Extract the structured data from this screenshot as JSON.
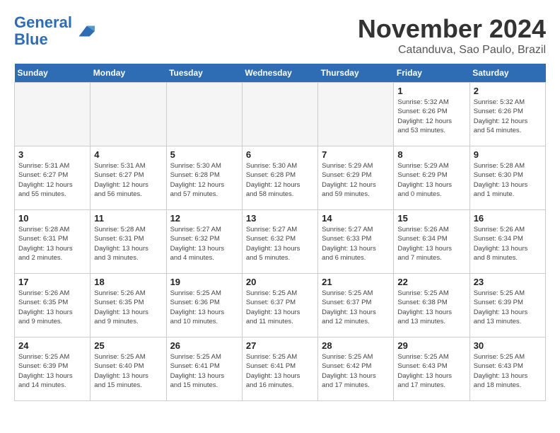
{
  "header": {
    "logo_line1": "General",
    "logo_line2": "Blue",
    "month_title": "November 2024",
    "location": "Catanduva, Sao Paulo, Brazil"
  },
  "days_of_week": [
    "Sunday",
    "Monday",
    "Tuesday",
    "Wednesday",
    "Thursday",
    "Friday",
    "Saturday"
  ],
  "weeks": [
    [
      {
        "day": "",
        "info": "",
        "empty": true
      },
      {
        "day": "",
        "info": "",
        "empty": true
      },
      {
        "day": "",
        "info": "",
        "empty": true
      },
      {
        "day": "",
        "info": "",
        "empty": true
      },
      {
        "day": "",
        "info": "",
        "empty": true
      },
      {
        "day": "1",
        "info": "Sunrise: 5:32 AM\nSunset: 6:26 PM\nDaylight: 12 hours\nand 53 minutes."
      },
      {
        "day": "2",
        "info": "Sunrise: 5:32 AM\nSunset: 6:26 PM\nDaylight: 12 hours\nand 54 minutes."
      }
    ],
    [
      {
        "day": "3",
        "info": "Sunrise: 5:31 AM\nSunset: 6:27 PM\nDaylight: 12 hours\nand 55 minutes."
      },
      {
        "day": "4",
        "info": "Sunrise: 5:31 AM\nSunset: 6:27 PM\nDaylight: 12 hours\nand 56 minutes."
      },
      {
        "day": "5",
        "info": "Sunrise: 5:30 AM\nSunset: 6:28 PM\nDaylight: 12 hours\nand 57 minutes."
      },
      {
        "day": "6",
        "info": "Sunrise: 5:30 AM\nSunset: 6:28 PM\nDaylight: 12 hours\nand 58 minutes."
      },
      {
        "day": "7",
        "info": "Sunrise: 5:29 AM\nSunset: 6:29 PM\nDaylight: 12 hours\nand 59 minutes."
      },
      {
        "day": "8",
        "info": "Sunrise: 5:29 AM\nSunset: 6:29 PM\nDaylight: 13 hours\nand 0 minutes."
      },
      {
        "day": "9",
        "info": "Sunrise: 5:28 AM\nSunset: 6:30 PM\nDaylight: 13 hours\nand 1 minute."
      }
    ],
    [
      {
        "day": "10",
        "info": "Sunrise: 5:28 AM\nSunset: 6:31 PM\nDaylight: 13 hours\nand 2 minutes."
      },
      {
        "day": "11",
        "info": "Sunrise: 5:28 AM\nSunset: 6:31 PM\nDaylight: 13 hours\nand 3 minutes."
      },
      {
        "day": "12",
        "info": "Sunrise: 5:27 AM\nSunset: 6:32 PM\nDaylight: 13 hours\nand 4 minutes."
      },
      {
        "day": "13",
        "info": "Sunrise: 5:27 AM\nSunset: 6:32 PM\nDaylight: 13 hours\nand 5 minutes."
      },
      {
        "day": "14",
        "info": "Sunrise: 5:27 AM\nSunset: 6:33 PM\nDaylight: 13 hours\nand 6 minutes."
      },
      {
        "day": "15",
        "info": "Sunrise: 5:26 AM\nSunset: 6:34 PM\nDaylight: 13 hours\nand 7 minutes."
      },
      {
        "day": "16",
        "info": "Sunrise: 5:26 AM\nSunset: 6:34 PM\nDaylight: 13 hours\nand 8 minutes."
      }
    ],
    [
      {
        "day": "17",
        "info": "Sunrise: 5:26 AM\nSunset: 6:35 PM\nDaylight: 13 hours\nand 9 minutes."
      },
      {
        "day": "18",
        "info": "Sunrise: 5:26 AM\nSunset: 6:35 PM\nDaylight: 13 hours\nand 9 minutes."
      },
      {
        "day": "19",
        "info": "Sunrise: 5:25 AM\nSunset: 6:36 PM\nDaylight: 13 hours\nand 10 minutes."
      },
      {
        "day": "20",
        "info": "Sunrise: 5:25 AM\nSunset: 6:37 PM\nDaylight: 13 hours\nand 11 minutes."
      },
      {
        "day": "21",
        "info": "Sunrise: 5:25 AM\nSunset: 6:37 PM\nDaylight: 13 hours\nand 12 minutes."
      },
      {
        "day": "22",
        "info": "Sunrise: 5:25 AM\nSunset: 6:38 PM\nDaylight: 13 hours\nand 13 minutes."
      },
      {
        "day": "23",
        "info": "Sunrise: 5:25 AM\nSunset: 6:39 PM\nDaylight: 13 hours\nand 13 minutes."
      }
    ],
    [
      {
        "day": "24",
        "info": "Sunrise: 5:25 AM\nSunset: 6:39 PM\nDaylight: 13 hours\nand 14 minutes."
      },
      {
        "day": "25",
        "info": "Sunrise: 5:25 AM\nSunset: 6:40 PM\nDaylight: 13 hours\nand 15 minutes."
      },
      {
        "day": "26",
        "info": "Sunrise: 5:25 AM\nSunset: 6:41 PM\nDaylight: 13 hours\nand 15 minutes."
      },
      {
        "day": "27",
        "info": "Sunrise: 5:25 AM\nSunset: 6:41 PM\nDaylight: 13 hours\nand 16 minutes."
      },
      {
        "day": "28",
        "info": "Sunrise: 5:25 AM\nSunset: 6:42 PM\nDaylight: 13 hours\nand 17 minutes."
      },
      {
        "day": "29",
        "info": "Sunrise: 5:25 AM\nSunset: 6:43 PM\nDaylight: 13 hours\nand 17 minutes."
      },
      {
        "day": "30",
        "info": "Sunrise: 5:25 AM\nSunset: 6:43 PM\nDaylight: 13 hours\nand 18 minutes."
      }
    ]
  ]
}
